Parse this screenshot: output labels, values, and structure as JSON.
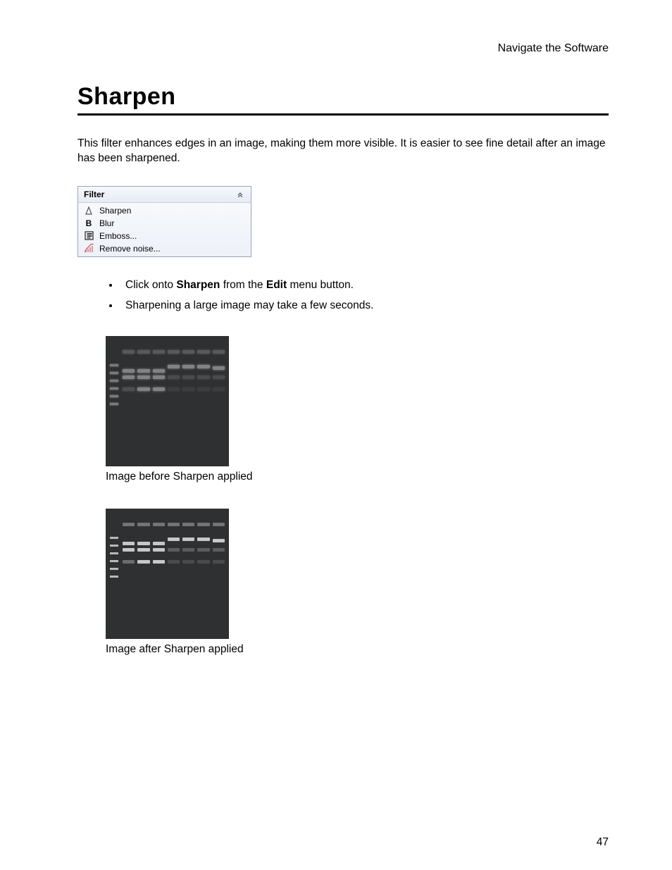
{
  "header": {
    "breadcrumb": "Navigate the Software"
  },
  "title": "Sharpen",
  "intro": "This filter enhances edges in an image, making them more visible. It is easier to see fine detail after an image has been sharpened.",
  "filter_panel": {
    "title": "Filter",
    "items": [
      {
        "icon": "sharpen-icon",
        "label": "Sharpen"
      },
      {
        "icon": "blur-icon",
        "label": "Blur"
      },
      {
        "icon": "emboss-icon",
        "label": "Emboss..."
      },
      {
        "icon": "noise-icon",
        "label": "Remove noise..."
      }
    ]
  },
  "instructions": {
    "item1_pre": "Click onto ",
    "item1_b1": "Sharpen",
    "item1_mid": " from the ",
    "item1_b2": "Edit",
    "item1_post": " menu button.",
    "item2": "Sharpening a large image may take a few seconds."
  },
  "captions": {
    "before": "Image before Sharpen applied",
    "after": "Image after Sharpen applied"
  },
  "page_number": "47"
}
